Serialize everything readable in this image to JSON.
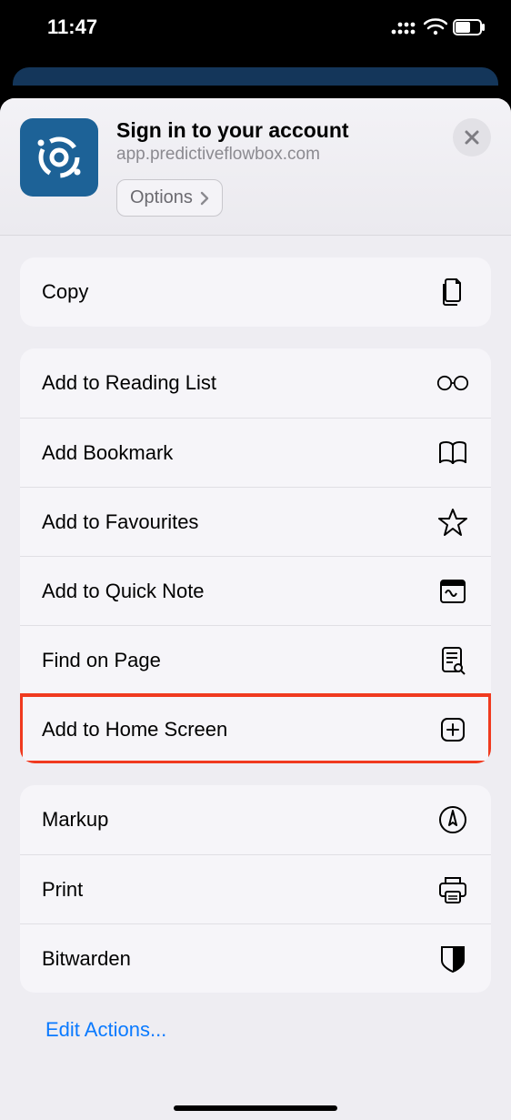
{
  "status": {
    "time": "11:47"
  },
  "header": {
    "title": "Sign in to your account",
    "subtitle": "app.predictiveflowbox.com",
    "options_label": "Options"
  },
  "group1": [
    {
      "label": "Copy"
    }
  ],
  "group2": [
    {
      "label": "Add to Reading List"
    },
    {
      "label": "Add Bookmark"
    },
    {
      "label": "Add to Favourites"
    },
    {
      "label": "Add to Quick Note"
    },
    {
      "label": "Find on Page"
    },
    {
      "label": "Add to Home Screen"
    }
  ],
  "group3": [
    {
      "label": "Markup"
    },
    {
      "label": "Print"
    },
    {
      "label": "Bitwarden"
    }
  ],
  "edit_actions": "Edit Actions..."
}
